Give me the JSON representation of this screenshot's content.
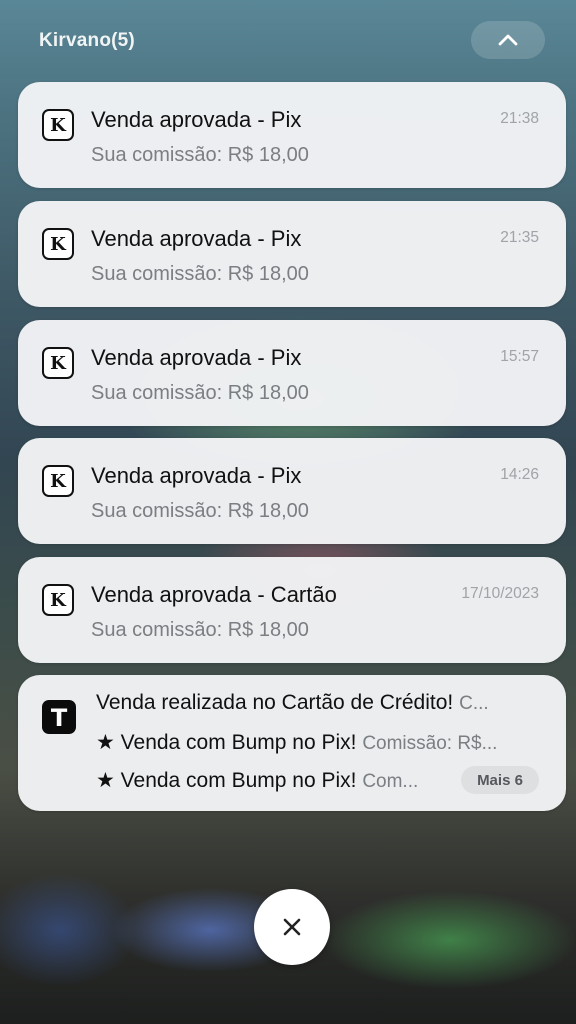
{
  "group": {
    "title": "Kirvano(5)",
    "collapse_icon": "chevron-up-icon"
  },
  "notifications": [
    {
      "app_icon": "K",
      "title": "Venda aprovada - Pix",
      "text": "Sua comissão: R$ 18,00",
      "time": "21:38"
    },
    {
      "app_icon": "K",
      "title": "Venda aprovada - Pix",
      "text": "Sua comissão: R$ 18,00",
      "time": "21:35"
    },
    {
      "app_icon": "K",
      "title": "Venda aprovada - Pix",
      "text": "Sua comissão: R$ 18,00",
      "time": "15:57"
    },
    {
      "app_icon": "K",
      "title": "Venda aprovada - Pix",
      "text": "Sua comissão: R$ 18,00",
      "time": "14:26"
    },
    {
      "app_icon": "K",
      "title": "Venda aprovada - Cartão",
      "text": "Sua comissão: R$ 18,00",
      "time": "17/10/2023"
    }
  ],
  "grouped_notification": {
    "app_icon": "T",
    "lines": [
      {
        "title": "Venda realizada no Cartão de Crédito!",
        "text": "C..."
      },
      {
        "title": "★ Venda com Bump no Pix!",
        "text": "Comissão: R$..."
      },
      {
        "title": "★ Venda com Bump no Pix!",
        "text": "Com..."
      }
    ],
    "more_label": "Mais 6"
  },
  "close_button": {
    "icon": "close-icon",
    "glyph": "×"
  }
}
